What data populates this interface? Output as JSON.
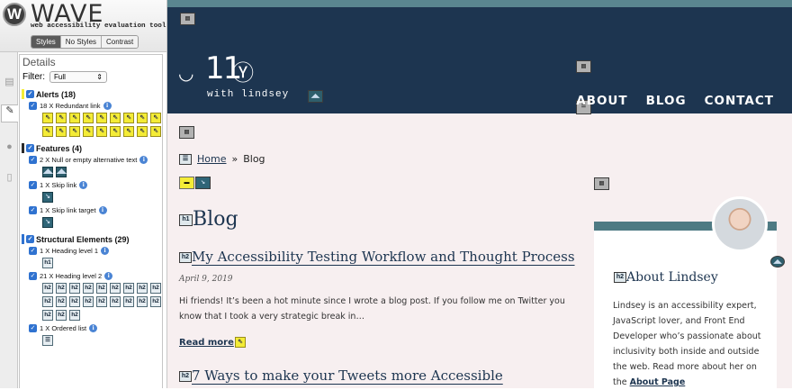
{
  "wave": {
    "logo_letter": "W",
    "title": "WAVE",
    "subtitle": "web accessibility evaluation tool",
    "modes": [
      "Styles",
      "No Styles",
      "Contrast"
    ],
    "details_title": "Details",
    "filter_label": "Filter:",
    "filter_value": "Full",
    "sections": {
      "alerts": {
        "title": "Alerts (18)",
        "color": "#f4ec36",
        "item": "18 X Redundant link"
      },
      "features": {
        "title": "Features (4)",
        "color": "#2b2b2b",
        "item1": "2 X Null or empty alternative text",
        "item2": "1 X Skip link",
        "item3": "1 X Skip link target"
      },
      "structure": {
        "title": "Structural Elements (29)",
        "color": "#2f72d0",
        "item1": "1 X Heading level 1",
        "item2": "21 X Heading level 2",
        "item3": "1 X Ordered list"
      }
    },
    "icon_labels": {
      "h1": "h1",
      "h2": "h2",
      "link": "⇖"
    }
  },
  "site": {
    "logo_num": "11",
    "logo_with": "with lindsey",
    "nav": [
      "ABOUT",
      "BLOG",
      "CONTACT"
    ],
    "breadcrumb": {
      "home": "Home",
      "sep": "»",
      "current": "Blog"
    },
    "h1": "Blog",
    "post1": {
      "title": "My Accessibility Testing Workflow and Thought Process",
      "date": "April 9, 2019",
      "excerpt": "Hi friends! It’s been a hot minute since I wrote a blog post. If you follow me on Twitter you know that I took a very strategic break in…",
      "read_more": "Read more"
    },
    "post2": {
      "title": "7 Ways to make your Tweets more Accessible"
    },
    "about": {
      "heading": "About Lindsey",
      "text": "Lindsey is an accessibility expert, JavaScript lover, and Front End Developer who’s passionate about inclusivity both inside and outside the web. Read more about her on the ",
      "link": "About Page"
    },
    "colors": {
      "header": "#1d3550",
      "strip": "#5a8690",
      "bg": "#f7eff0"
    }
  }
}
